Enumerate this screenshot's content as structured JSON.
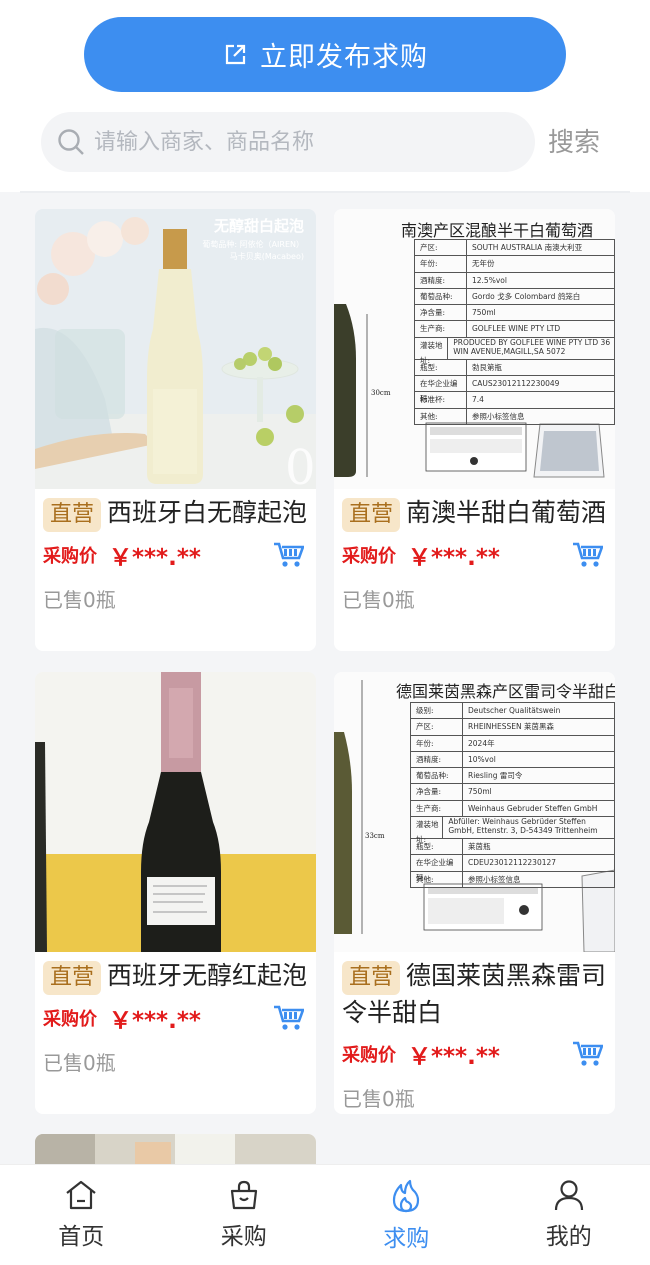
{
  "publish_button": {
    "label": "立即发布求购"
  },
  "search": {
    "placeholder": "请输入商家、商品名称",
    "value": "",
    "button_label": "搜索"
  },
  "products": [
    {
      "badge": "直营",
      "name": "西班牙白无醇起泡",
      "price_label": "采购价",
      "price": "￥***.**",
      "sold": "已售0瓶",
      "image_text": {
        "title": "无醇甜白起泡",
        "line1": "葡萄品种: 阿依伦（AIREN）",
        "line2": "马卡贝奥(Macabeo)",
        "big_digit": "0"
      }
    },
    {
      "badge": "直营",
      "name": "南澳半甜白葡萄酒",
      "price_label": "采购价",
      "price": "￥***.**",
      "sold": "已售0瓶",
      "image_text": {
        "title": "南澳产区混酿半干白葡萄酒",
        "side_mark": "30cm",
        "specs": [
          {
            "k": "产区:",
            "v": "SOUTH AUSTRALIA 南澳大利亚"
          },
          {
            "k": "年份:",
            "v": "无年份"
          },
          {
            "k": "酒精度:",
            "v": "12.5%vol"
          },
          {
            "k": "葡萄品种:",
            "v": "Gordo 戈多  Colombard 鸽笼白"
          },
          {
            "k": "净含量:",
            "v": "750ml"
          },
          {
            "k": "生产商:",
            "v": "GOLFLEE WINE PTY LTD"
          },
          {
            "k": "灌装地址:",
            "v": "PRODUCED BY GOLFLEE WINE PTY LTD 36 WIN AVENUE,MAGILL,SA 5072"
          },
          {
            "k": "瓶型:",
            "v": "勃艮第瓶"
          },
          {
            "k": "在华企业编码:",
            "v": "CAUS23012112230049"
          },
          {
            "k": "标准杯:",
            "v": "7.4"
          },
          {
            "k": "其他:",
            "v": "参照小标签信息"
          }
        ]
      }
    },
    {
      "badge": "直营",
      "name": "西班牙无醇红起泡",
      "price_label": "采购价",
      "price": "￥***.**",
      "sold": "已售0瓶",
      "image_text": {}
    },
    {
      "badge": "直营",
      "name": "德国莱茵黑森雷司令半甜白",
      "price_label": "采购价",
      "price": "￥***.**",
      "sold": "已售0瓶",
      "image_text": {
        "title": "德国莱茵黑森产区雷司令半甜白",
        "side_mark": "33cm",
        "specs": [
          {
            "k": "级别:",
            "v": "Deutscher Qualitätswein"
          },
          {
            "k": "产区:",
            "v": "RHEINHESSEN 莱茵黑森"
          },
          {
            "k": "年份:",
            "v": "2024年"
          },
          {
            "k": "酒精度:",
            "v": "10%vol"
          },
          {
            "k": "葡萄品种:",
            "v": "Riesling 雷司令"
          },
          {
            "k": "净含量:",
            "v": "750ml"
          },
          {
            "k": "生产商:",
            "v": "Weinhaus Gebruder Steffen GmbH"
          },
          {
            "k": "灌装地址:",
            "v": "Abfüller: Weinhaus Gebrüder Steffen GmbH, Ettenstr. 3, D-54349 Trittenheim"
          },
          {
            "k": "瓶型:",
            "v": "莱茵瓶"
          },
          {
            "k": "在华企业编码:",
            "v": "CDEU23012112230127"
          },
          {
            "k": "其他:",
            "v": "参照小标签信息"
          }
        ]
      }
    }
  ],
  "tabbar": [
    {
      "label": "首页",
      "icon": "home-icon"
    },
    {
      "label": "采购",
      "icon": "bag-icon"
    },
    {
      "label": "求购",
      "icon": "flame-icon",
      "active": true
    },
    {
      "label": "我的",
      "icon": "user-icon"
    }
  ],
  "colors": {
    "accent": "#3d8ef0",
    "price": "#e21b1b",
    "badge_bg": "#f7e6c9",
    "badge_text": "#a96f1e"
  }
}
